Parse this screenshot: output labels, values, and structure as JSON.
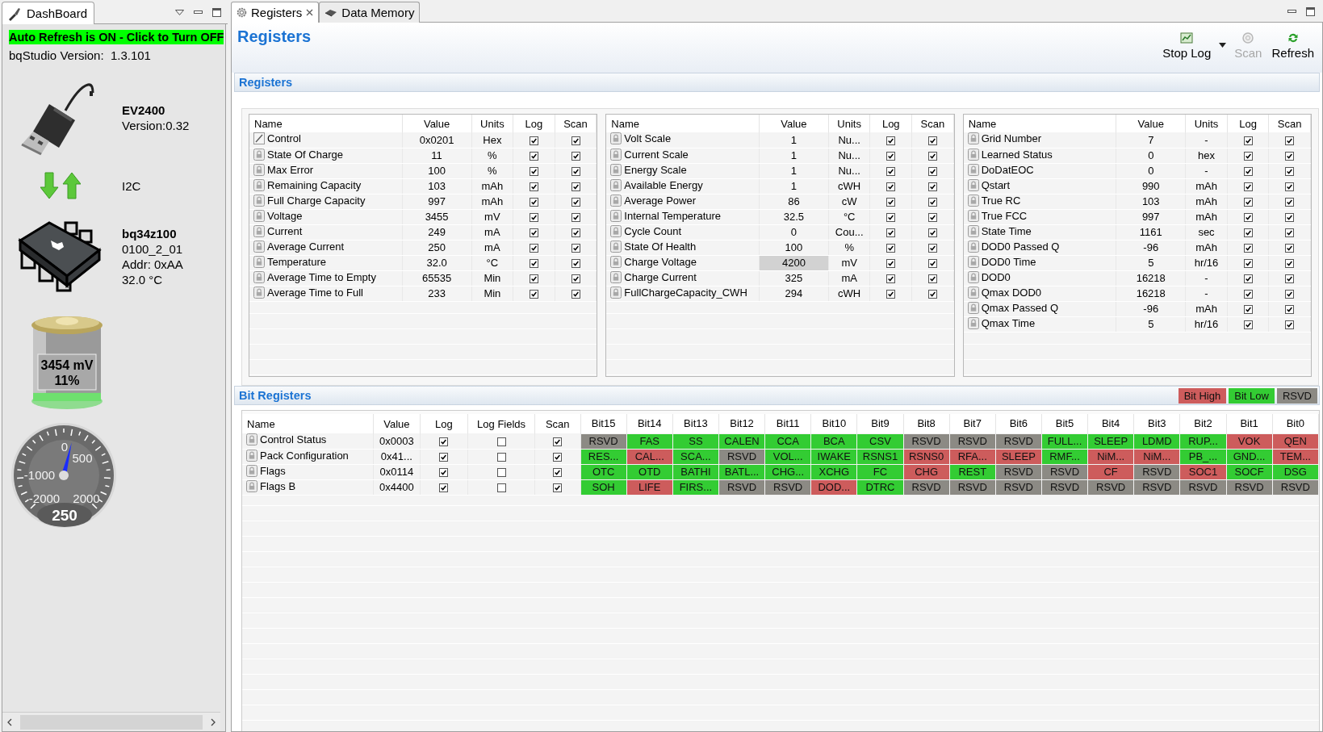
{
  "dashboard_tab": {
    "label": "DashBoard",
    "selected": true
  },
  "auto_refresh": {
    "label": "Auto Refresh is ON - Click to Turn OFF",
    "on": true
  },
  "version": {
    "label": "bqStudio Version:",
    "value": "1.3.101"
  },
  "adapter": {
    "name": "EV2400",
    "version": "Version:0.32"
  },
  "bus": {
    "label": "I2C"
  },
  "device": {
    "name": "bq34z100",
    "firmware": "0100_2_01",
    "address": "Addr: 0xAA",
    "temperature": "32.0 °C"
  },
  "battery": {
    "voltage": "3454 mV",
    "charge": "11%",
    "level": 0.11
  },
  "gauge": {
    "tick_labels": [
      "0",
      "500",
      "-1000",
      "-2000",
      "2000"
    ],
    "reading": "250",
    "level": 0.55
  },
  "tabs": [
    {
      "label": "Registers",
      "kind": "registers",
      "selected": true
    },
    {
      "label": "Data Memory",
      "kind": "memory",
      "selected": false
    }
  ],
  "page_title": "Registers",
  "toolbar": [
    {
      "kind": "log",
      "label": "Stop Log",
      "disabled": false
    },
    {
      "kind": "scan",
      "label": "Scan",
      "disabled": true
    },
    {
      "kind": "refresh",
      "label": "Refresh",
      "disabled": false
    }
  ],
  "registers_section": {
    "title": "Registers",
    "tables": [
      {
        "columns": [
          "Name",
          "Value",
          "Units",
          "Log",
          "Scan"
        ],
        "rows": [
          {
            "kind": "edit",
            "name": "Control",
            "value": "0x0201",
            "units": "Hex",
            "log": true,
            "scan": true,
            "selected": false
          },
          {
            "kind": "lock",
            "name": "State Of Charge",
            "value": "11",
            "units": "%",
            "log": true,
            "scan": true,
            "selected": false
          },
          {
            "kind": "lock",
            "name": "Max Error",
            "value": "100",
            "units": "%",
            "log": true,
            "scan": true,
            "selected": false
          },
          {
            "kind": "lock",
            "name": "Remaining Capacity",
            "value": "103",
            "units": "mAh",
            "log": true,
            "scan": true,
            "selected": false
          },
          {
            "kind": "lock",
            "name": "Full Charge Capacity",
            "value": "997",
            "units": "mAh",
            "log": true,
            "scan": true,
            "selected": false
          },
          {
            "kind": "lock",
            "name": "Voltage",
            "value": "3455",
            "units": "mV",
            "log": true,
            "scan": true,
            "selected": false
          },
          {
            "kind": "lock",
            "name": "Current",
            "value": "249",
            "units": "mA",
            "log": true,
            "scan": true,
            "selected": false
          },
          {
            "kind": "lock",
            "name": "Average Current",
            "value": "250",
            "units": "mA",
            "log": true,
            "scan": true,
            "selected": false
          },
          {
            "kind": "lock",
            "name": "Temperature",
            "value": "32.0",
            "units": "°C",
            "log": true,
            "scan": true,
            "selected": false
          },
          {
            "kind": "lock",
            "name": "Average Time to Empty",
            "value": "65535",
            "units": "Min",
            "log": true,
            "scan": true,
            "selected": false
          },
          {
            "kind": "lock",
            "name": "Average Time to Full",
            "value": "233",
            "units": "Min",
            "log": true,
            "scan": true,
            "selected": false
          }
        ]
      },
      {
        "columns": [
          "Name",
          "Value",
          "Units",
          "Log",
          "Scan"
        ],
        "rows": [
          {
            "kind": "lock",
            "name": "Volt Scale",
            "value": "1",
            "units": "Nu...",
            "log": true,
            "scan": true,
            "selected": false
          },
          {
            "kind": "lock",
            "name": "Current Scale",
            "value": "1",
            "units": "Nu...",
            "log": true,
            "scan": true,
            "selected": false
          },
          {
            "kind": "lock",
            "name": "Energy Scale",
            "value": "1",
            "units": "Nu...",
            "log": true,
            "scan": true,
            "selected": false
          },
          {
            "kind": "lock",
            "name": "Available Energy",
            "value": "1",
            "units": "cWH",
            "log": true,
            "scan": true,
            "selected": false
          },
          {
            "kind": "lock",
            "name": "Average Power",
            "value": "86",
            "units": "cW",
            "log": true,
            "scan": true,
            "selected": false
          },
          {
            "kind": "lock",
            "name": "Internal Temperature",
            "value": "32.5",
            "units": "°C",
            "log": true,
            "scan": true,
            "selected": false
          },
          {
            "kind": "lock",
            "name": "Cycle Count",
            "value": "0",
            "units": "Cou...",
            "log": true,
            "scan": true,
            "selected": false
          },
          {
            "kind": "lock",
            "name": "State Of Health",
            "value": "100",
            "units": "%",
            "log": true,
            "scan": true,
            "selected": false
          },
          {
            "kind": "lock",
            "name": "Charge Voltage",
            "value": "4200",
            "units": "mV",
            "log": true,
            "scan": true,
            "selected": true
          },
          {
            "kind": "lock",
            "name": "Charge Current",
            "value": "325",
            "units": "mA",
            "log": true,
            "scan": true,
            "selected": false
          },
          {
            "kind": "lock",
            "name": "FullChargeCapacity_CWH",
            "value": "294",
            "units": "cWH",
            "log": true,
            "scan": true,
            "selected": false
          }
        ]
      },
      {
        "columns": [
          "Name",
          "Value",
          "Units",
          "Log",
          "Scan"
        ],
        "rows": [
          {
            "kind": "lock",
            "name": "Grid Number",
            "value": "7",
            "units": "-",
            "log": true,
            "scan": true,
            "selected": false
          },
          {
            "kind": "lock",
            "name": "Learned Status",
            "value": "0",
            "units": "hex",
            "log": true,
            "scan": true,
            "selected": false
          },
          {
            "kind": "lock",
            "name": "DoDatEOC",
            "value": "0",
            "units": "-",
            "log": true,
            "scan": true,
            "selected": false
          },
          {
            "kind": "lock",
            "name": "Qstart",
            "value": "990",
            "units": "mAh",
            "log": true,
            "scan": true,
            "selected": false
          },
          {
            "kind": "lock",
            "name": "True RC",
            "value": "103",
            "units": "mAh",
            "log": true,
            "scan": true,
            "selected": false
          },
          {
            "kind": "lock",
            "name": "True FCC",
            "value": "997",
            "units": "mAh",
            "log": true,
            "scan": true,
            "selected": false
          },
          {
            "kind": "lock",
            "name": "State Time",
            "value": "1161",
            "units": "sec",
            "log": true,
            "scan": true,
            "selected": false
          },
          {
            "kind": "lock",
            "name": "DOD0 Passed Q",
            "value": "-96",
            "units": "mAh",
            "log": true,
            "scan": true,
            "selected": false
          },
          {
            "kind": "lock",
            "name": "DOD0 Time",
            "value": "5",
            "units": "hr/16",
            "log": true,
            "scan": true,
            "selected": false
          },
          {
            "kind": "lock",
            "name": "DOD0",
            "value": "16218",
            "units": "-",
            "log": true,
            "scan": true,
            "selected": false
          },
          {
            "kind": "lock",
            "name": "Qmax DOD0",
            "value": "16218",
            "units": "-",
            "log": true,
            "scan": true,
            "selected": false
          },
          {
            "kind": "lock",
            "name": "Qmax Passed Q",
            "value": "-96",
            "units": "mAh",
            "log": true,
            "scan": true,
            "selected": false
          },
          {
            "kind": "lock",
            "name": "Qmax Time",
            "value": "5",
            "units": "hr/16",
            "log": true,
            "scan": true,
            "selected": false
          }
        ]
      }
    ]
  },
  "bit_registers_section": {
    "title": "Bit Registers",
    "legend": [
      {
        "label": "Bit High",
        "color": "#cd5c5c"
      },
      {
        "label": "Bit Low",
        "color": "#33cc33"
      },
      {
        "label": "RSVD",
        "color": "#8c8a84"
      }
    ],
    "columns": [
      "Name",
      "Value",
      "Log",
      "Log Fields",
      "Scan",
      "Bit15",
      "Bit14",
      "Bit13",
      "Bit12",
      "Bit11",
      "Bit10",
      "Bit9",
      "Bit8",
      "Bit7",
      "Bit6",
      "Bit5",
      "Bit4",
      "Bit3",
      "Bit2",
      "Bit1",
      "Bit0"
    ],
    "rows": [
      {
        "name": "Control Status",
        "value": "0x0003",
        "log": true,
        "log_fields": false,
        "scan": true,
        "bits": [
          {
            "label": "RSVD",
            "color": "#8c8a84"
          },
          {
            "label": "FAS",
            "color": "#33cc33"
          },
          {
            "label": "SS",
            "color": "#33cc33"
          },
          {
            "label": "CALEN",
            "color": "#33cc33"
          },
          {
            "label": "CCA",
            "color": "#33cc33"
          },
          {
            "label": "BCA",
            "color": "#33cc33"
          },
          {
            "label": "CSV",
            "color": "#33cc33"
          },
          {
            "label": "RSVD",
            "color": "#8c8a84"
          },
          {
            "label": "RSVD",
            "color": "#8c8a84"
          },
          {
            "label": "RSVD",
            "color": "#8c8a84"
          },
          {
            "label": "FULL...",
            "color": "#33cc33"
          },
          {
            "label": "SLEEP",
            "color": "#33cc33"
          },
          {
            "label": "LDMD",
            "color": "#33cc33"
          },
          {
            "label": "RUP...",
            "color": "#33cc33"
          },
          {
            "label": "VOK",
            "color": "#cd5c5c"
          },
          {
            "label": "QEN",
            "color": "#cd5c5c"
          }
        ]
      },
      {
        "name": "Pack Configuration",
        "value": "0x41...",
        "log": true,
        "log_fields": false,
        "scan": true,
        "bits": [
          {
            "label": "RES...",
            "color": "#33cc33"
          },
          {
            "label": "CAL...",
            "color": "#cd5c5c"
          },
          {
            "label": "SCA...",
            "color": "#33cc33"
          },
          {
            "label": "RSVD",
            "color": "#8c8a84"
          },
          {
            "label": "VOL...",
            "color": "#33cc33"
          },
          {
            "label": "IWAKE",
            "color": "#33cc33"
          },
          {
            "label": "RSNS1",
            "color": "#33cc33"
          },
          {
            "label": "RSNS0",
            "color": "#cd5c5c"
          },
          {
            "label": "RFA...",
            "color": "#cd5c5c"
          },
          {
            "label": "SLEEP",
            "color": "#cd5c5c"
          },
          {
            "label": "RMF...",
            "color": "#33cc33"
          },
          {
            "label": "NiM...",
            "color": "#cd5c5c"
          },
          {
            "label": "NiM...",
            "color": "#cd5c5c"
          },
          {
            "label": "PB_...",
            "color": "#33cc33"
          },
          {
            "label": "GND...",
            "color": "#33cc33"
          },
          {
            "label": "TEM...",
            "color": "#cd5c5c"
          }
        ]
      },
      {
        "name": "Flags",
        "value": "0x0114",
        "log": true,
        "log_fields": false,
        "scan": true,
        "bits": [
          {
            "label": "OTC",
            "color": "#33cc33"
          },
          {
            "label": "OTD",
            "color": "#33cc33"
          },
          {
            "label": "BATHI",
            "color": "#33cc33"
          },
          {
            "label": "BATL...",
            "color": "#33cc33"
          },
          {
            "label": "CHG...",
            "color": "#33cc33"
          },
          {
            "label": "XCHG",
            "color": "#33cc33"
          },
          {
            "label": "FC",
            "color": "#33cc33"
          },
          {
            "label": "CHG",
            "color": "#cd5c5c"
          },
          {
            "label": "REST",
            "color": "#33cc33"
          },
          {
            "label": "RSVD",
            "color": "#8c8a84"
          },
          {
            "label": "RSVD",
            "color": "#8c8a84"
          },
          {
            "label": "CF",
            "color": "#cd5c5c"
          },
          {
            "label": "RSVD",
            "color": "#8c8a84"
          },
          {
            "label": "SOC1",
            "color": "#cd5c5c"
          },
          {
            "label": "SOCF",
            "color": "#33cc33"
          },
          {
            "label": "DSG",
            "color": "#33cc33"
          }
        ]
      },
      {
        "name": "Flags B",
        "value": "0x4400",
        "log": true,
        "log_fields": false,
        "scan": true,
        "bits": [
          {
            "label": "SOH",
            "color": "#33cc33"
          },
          {
            "label": "LIFE",
            "color": "#cd5c5c"
          },
          {
            "label": "FIRS...",
            "color": "#33cc33"
          },
          {
            "label": "RSVD",
            "color": "#8c8a84"
          },
          {
            "label": "RSVD",
            "color": "#8c8a84"
          },
          {
            "label": "DOD...",
            "color": "#cd5c5c"
          },
          {
            "label": "DTRC",
            "color": "#33cc33"
          },
          {
            "label": "RSVD",
            "color": "#8c8a84"
          },
          {
            "label": "RSVD",
            "color": "#8c8a84"
          },
          {
            "label": "RSVD",
            "color": "#8c8a84"
          },
          {
            "label": "RSVD",
            "color": "#8c8a84"
          },
          {
            "label": "RSVD",
            "color": "#8c8a84"
          },
          {
            "label": "RSVD",
            "color": "#8c8a84"
          },
          {
            "label": "RSVD",
            "color": "#8c8a84"
          },
          {
            "label": "RSVD",
            "color": "#8c8a84"
          },
          {
            "label": "RSVD",
            "color": "#8c8a84"
          }
        ]
      }
    ]
  }
}
